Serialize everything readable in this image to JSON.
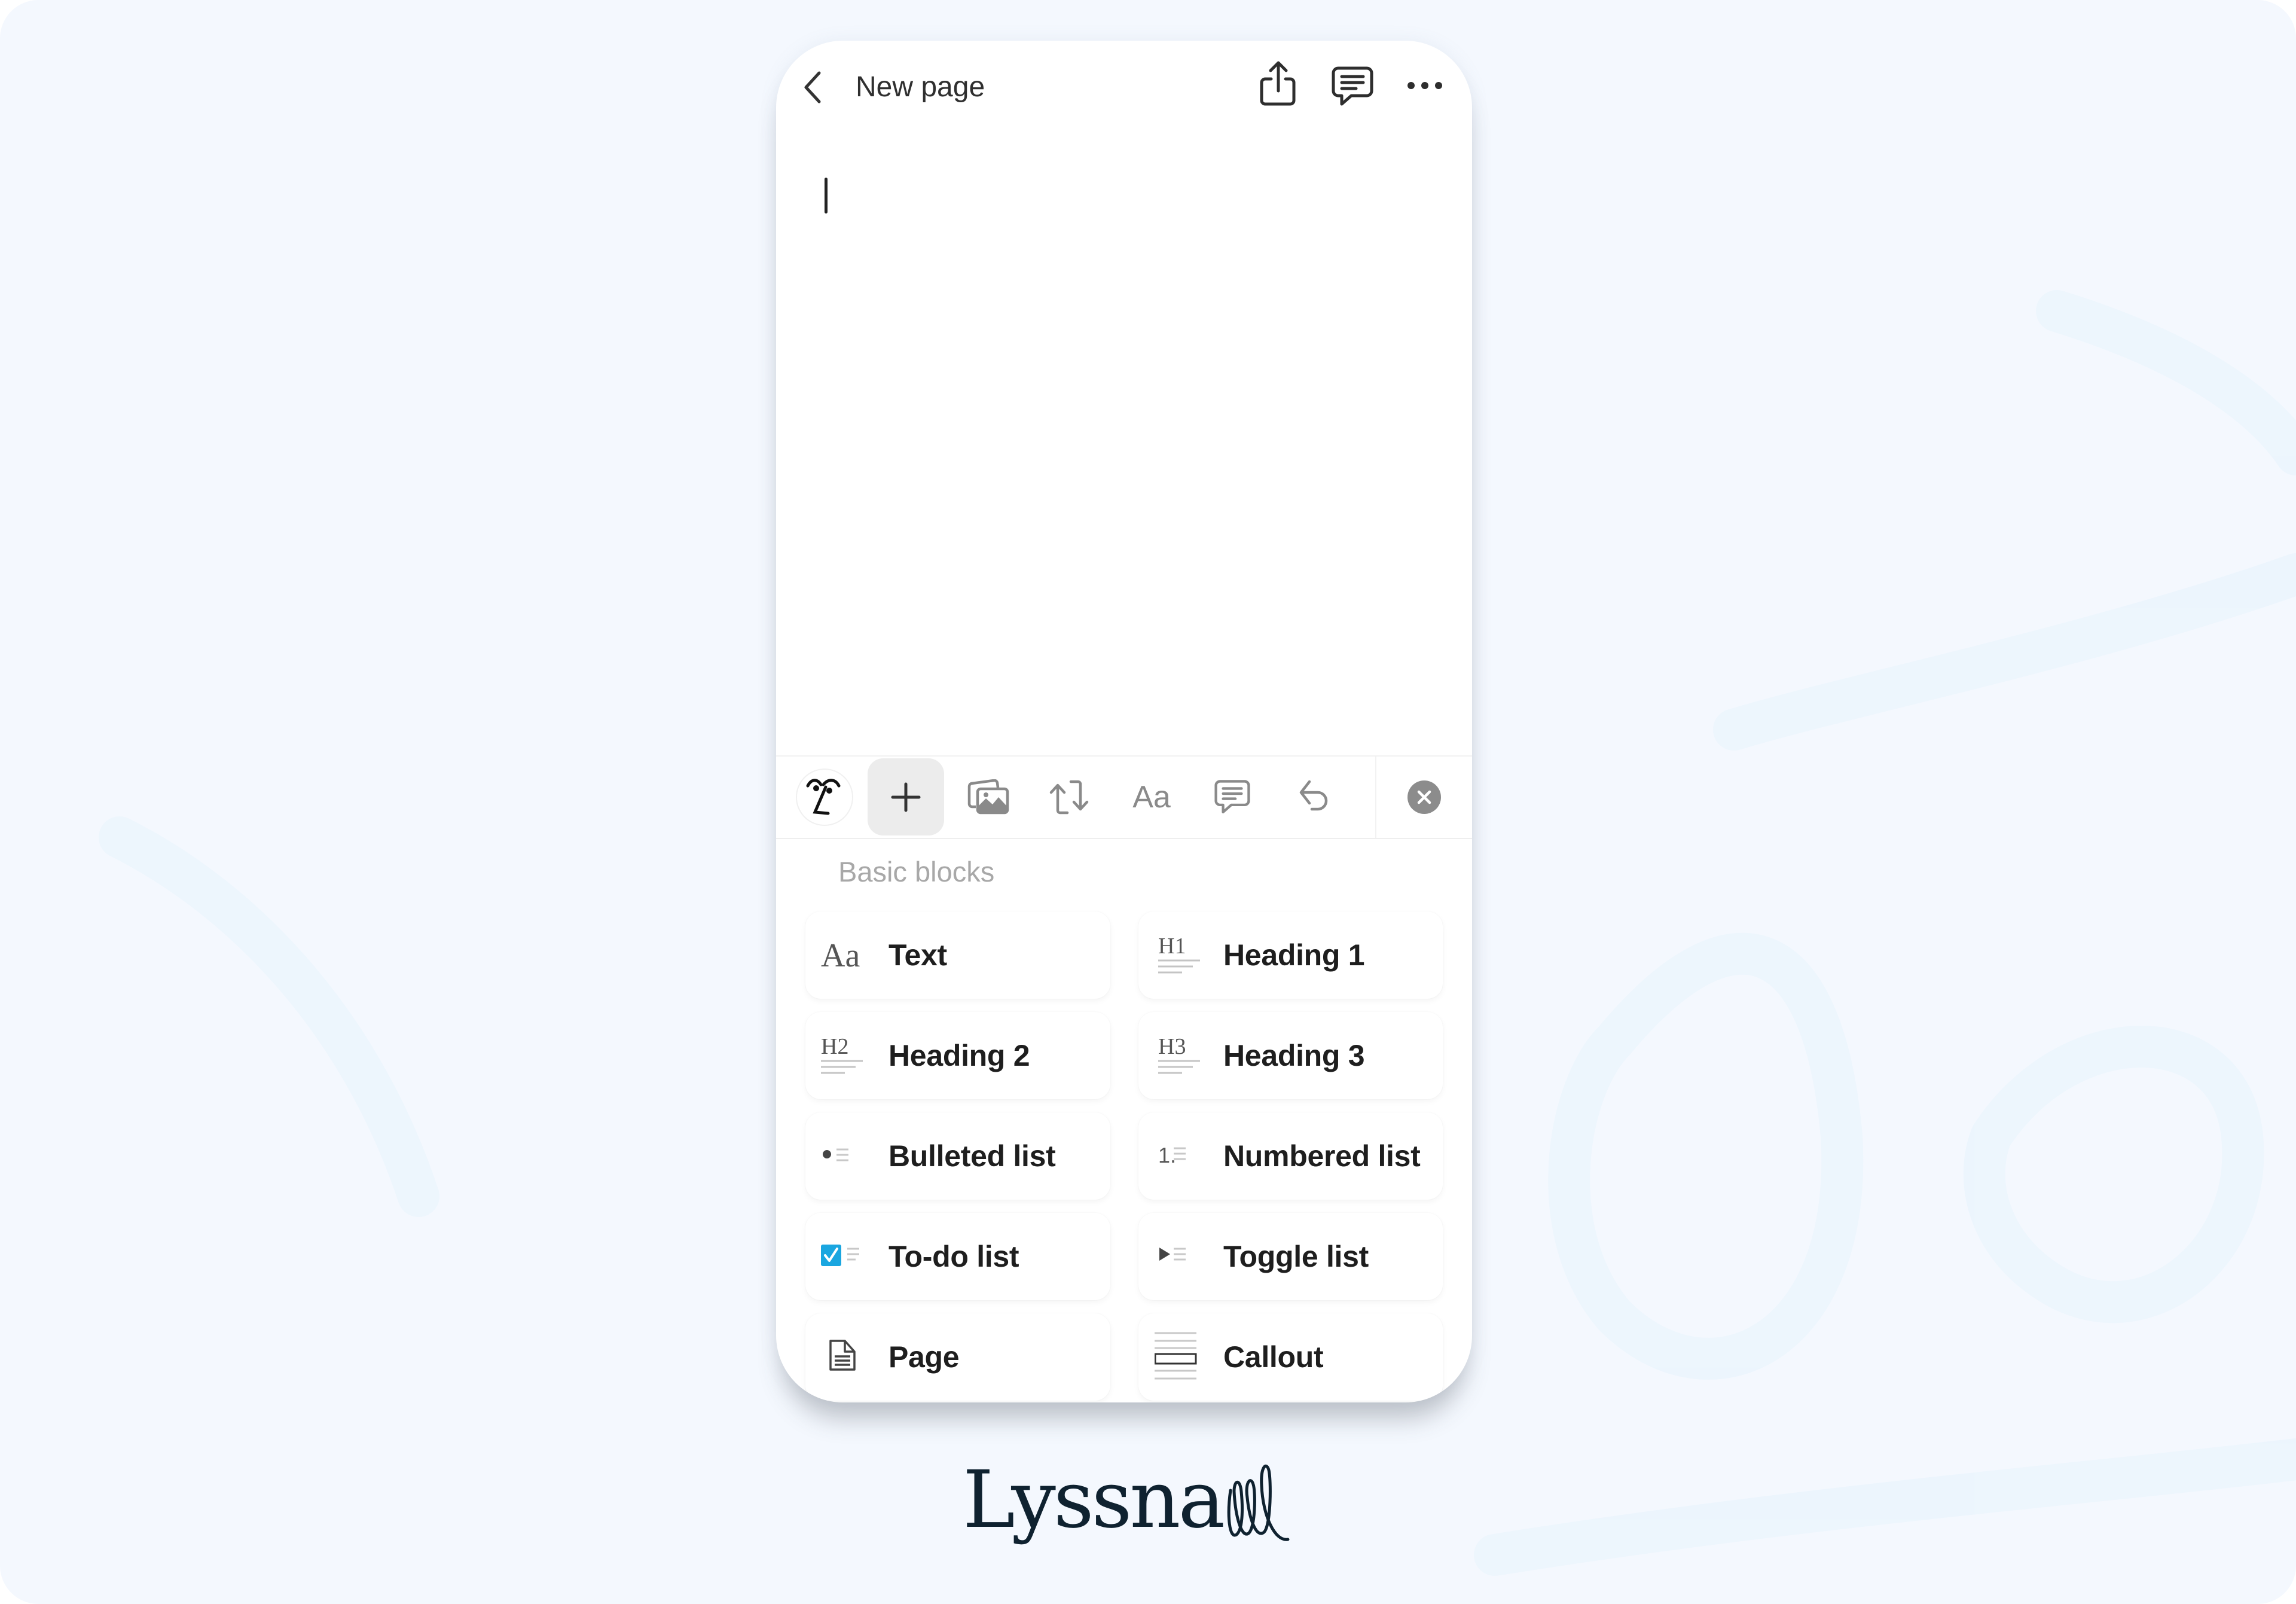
{
  "header": {
    "back_icon": "chevron-left-icon",
    "title": "New page",
    "actions": [
      {
        "name": "share",
        "icon": "share-icon"
      },
      {
        "name": "comments",
        "icon": "comment-icon"
      },
      {
        "name": "more",
        "icon": "ellipsis-icon"
      }
    ]
  },
  "editor": {
    "content": "",
    "cursor_visible": true
  },
  "toolbar": {
    "items": [
      {
        "name": "ai-assistant",
        "icon": "ai-face-icon"
      },
      {
        "name": "add-block",
        "icon": "plus-icon",
        "active": true
      },
      {
        "name": "media",
        "icon": "image-icon"
      },
      {
        "name": "turn-into",
        "icon": "turn-into-icon"
      },
      {
        "name": "text-style",
        "icon": "text-style-icon",
        "label": "Aa"
      },
      {
        "name": "comment",
        "icon": "comment-icon"
      },
      {
        "name": "undo",
        "icon": "undo-icon"
      },
      {
        "name": "close",
        "icon": "close-icon"
      }
    ]
  },
  "block_menu": {
    "section_title": "Basic blocks",
    "blocks": [
      {
        "label": "Text",
        "icon": "text-aa-icon",
        "icon_text": "Aa"
      },
      {
        "label": "Heading 1",
        "icon": "heading-1-icon",
        "icon_text": "H1"
      },
      {
        "label": "Heading 2",
        "icon": "heading-2-icon",
        "icon_text": "H2"
      },
      {
        "label": "Heading 3",
        "icon": "heading-3-icon",
        "icon_text": "H3"
      },
      {
        "label": "Bulleted list",
        "icon": "bulleted-list-icon"
      },
      {
        "label": "Numbered list",
        "icon": "numbered-list-icon",
        "icon_text": "1."
      },
      {
        "label": "To-do list",
        "icon": "todo-checkbox-icon"
      },
      {
        "label": "Toggle list",
        "icon": "toggle-triangle-icon"
      },
      {
        "label": "Page",
        "icon": "page-document-icon"
      },
      {
        "label": "Callout",
        "icon": "callout-icon"
      }
    ]
  },
  "branding": {
    "logo_text": "Lyssna"
  },
  "colors": {
    "background": "#f4f8fe",
    "todo_checkbox": "#1aa6e0",
    "toolbar_icon": "#8a8a8a",
    "close_button": "#8c8c8c",
    "section_label": "#a8a8a8",
    "logo": "#0f2230"
  }
}
